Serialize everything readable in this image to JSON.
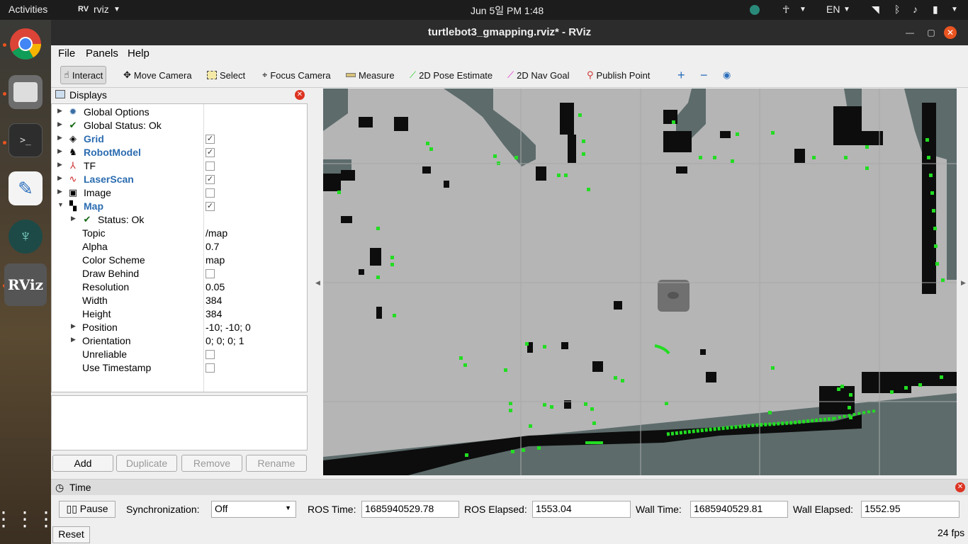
{
  "topbar": {
    "activities": "Activities",
    "app_name": "rviz",
    "clock": "Jun 5일  PM  1:48",
    "lang": "EN"
  },
  "window": {
    "title": "turtlebot3_gmapping.rviz* - RViz"
  },
  "menu": [
    "File",
    "Panels",
    "Help"
  ],
  "toolbar": {
    "interact": "Interact",
    "move_camera": "Move Camera",
    "select": "Select",
    "focus_camera": "Focus Camera",
    "measure": "Measure",
    "pose_estimate": "2D Pose Estimate",
    "nav_goal": "2D Nav Goal",
    "publish_point": "Publish Point"
  },
  "displays": {
    "title": "Displays",
    "rows": [
      {
        "name": "Global Options"
      },
      {
        "name": "Global Status: Ok"
      },
      {
        "name": "Grid",
        "checked": true
      },
      {
        "name": "RobotModel",
        "checked": true
      },
      {
        "name": "TF",
        "checked": false
      },
      {
        "name": "LaserScan",
        "checked": true
      },
      {
        "name": "Image",
        "checked": false
      },
      {
        "name": "Map",
        "checked": true
      },
      {
        "name": "Status: Ok"
      },
      {
        "name": "Topic",
        "value": "/map"
      },
      {
        "name": "Alpha",
        "value": "0.7"
      },
      {
        "name": "Color Scheme",
        "value": "map"
      },
      {
        "name": "Draw Behind",
        "checked": false
      },
      {
        "name": "Resolution",
        "value": "0.05"
      },
      {
        "name": "Width",
        "value": "384"
      },
      {
        "name": "Height",
        "value": "384"
      },
      {
        "name": "Position",
        "value": "-10; -10; 0"
      },
      {
        "name": "Orientation",
        "value": "0; 0; 0; 1"
      },
      {
        "name": "Unreliable",
        "checked": false
      },
      {
        "name": "Use Timestamp",
        "checked": false
      }
    ],
    "buttons": {
      "add": "Add",
      "duplicate": "Duplicate",
      "remove": "Remove",
      "rename": "Rename"
    }
  },
  "time": {
    "title": "Time",
    "pause": "Pause",
    "sync_label": "Synchronization:",
    "sync_value": "Off",
    "ros_time_label": "ROS Time:",
    "ros_time": "1685940529.78",
    "ros_elapsed_label": "ROS Elapsed:",
    "ros_elapsed": "1553.04",
    "wall_time_label": "Wall Time:",
    "wall_time": "1685940529.81",
    "wall_elapsed_label": "Wall Elapsed:",
    "wall_elapsed": "1552.95",
    "reset": "Reset",
    "fps": "24 fps"
  },
  "colors": {
    "map_free": "#b5b5b5",
    "map_unknown": "#5d6b6b",
    "map_occupied": "#0d0d0d",
    "laser": "#22dd22",
    "link_blue": "#2b6cb0",
    "accent": "#e95420"
  }
}
